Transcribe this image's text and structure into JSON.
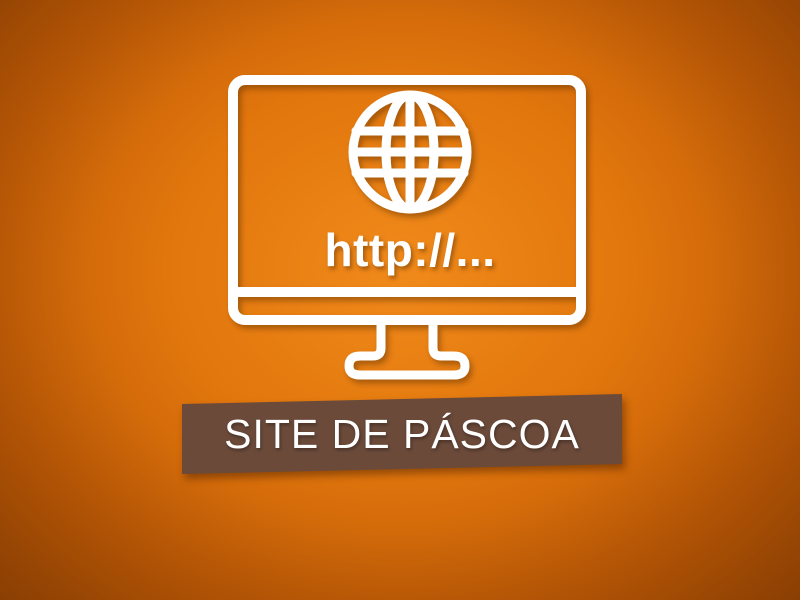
{
  "colors": {
    "background": "#e2770d",
    "icon_stroke": "#ffffff",
    "banner_background": "#6b4a3a",
    "banner_text": "#ffffff"
  },
  "monitor": {
    "icon": "monitor-icon",
    "globe_icon": "globe-icon",
    "url_text": "http://..."
  },
  "banner": {
    "label": "SITE DE PÁSCOA"
  }
}
